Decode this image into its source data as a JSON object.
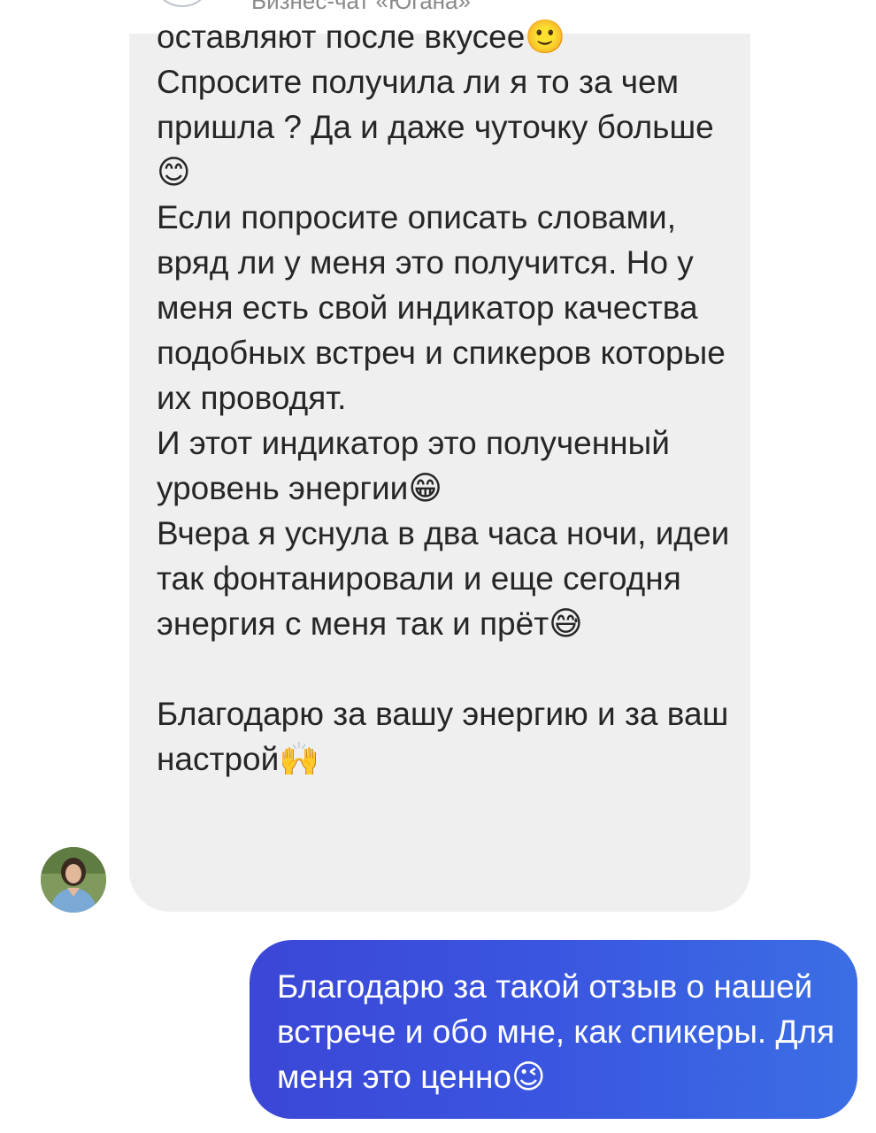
{
  "header": {
    "title": "Бизнес-чат «Югана»"
  },
  "incoming_message": {
    "text": "оставляют после вкусее🙂\nСпросите получила ли я то за чем пришла ? Да и даже чуточку больше😊\nЕсли попросите описать словами, вряд ли у меня это получится. Но у меня есть свой индикатор качества подобных встреч и спикеров которые их проводят.\nИ этот индикатор это полученный уровень энергии😁\nВчера я уснула в два часа ночи, идеи так фонтанировали и еще сегодня энергия с меня так и прёт😅\n\nБлагодарю за вашу энергию и за ваш настрой🙌",
    "avatar_icon": "user-avatar"
  },
  "outgoing_message": {
    "text": "Благодарю за такой отзыв о нашей встрече и обо мне, как спикеры. Для меня это ценно😉"
  },
  "colors": {
    "incoming_bubble": "#efefef",
    "outgoing_bubble_start": "#3b47d6",
    "outgoing_bubble_end": "#3b6ee4",
    "text_dark": "#262626",
    "text_light": "#ffffff"
  }
}
